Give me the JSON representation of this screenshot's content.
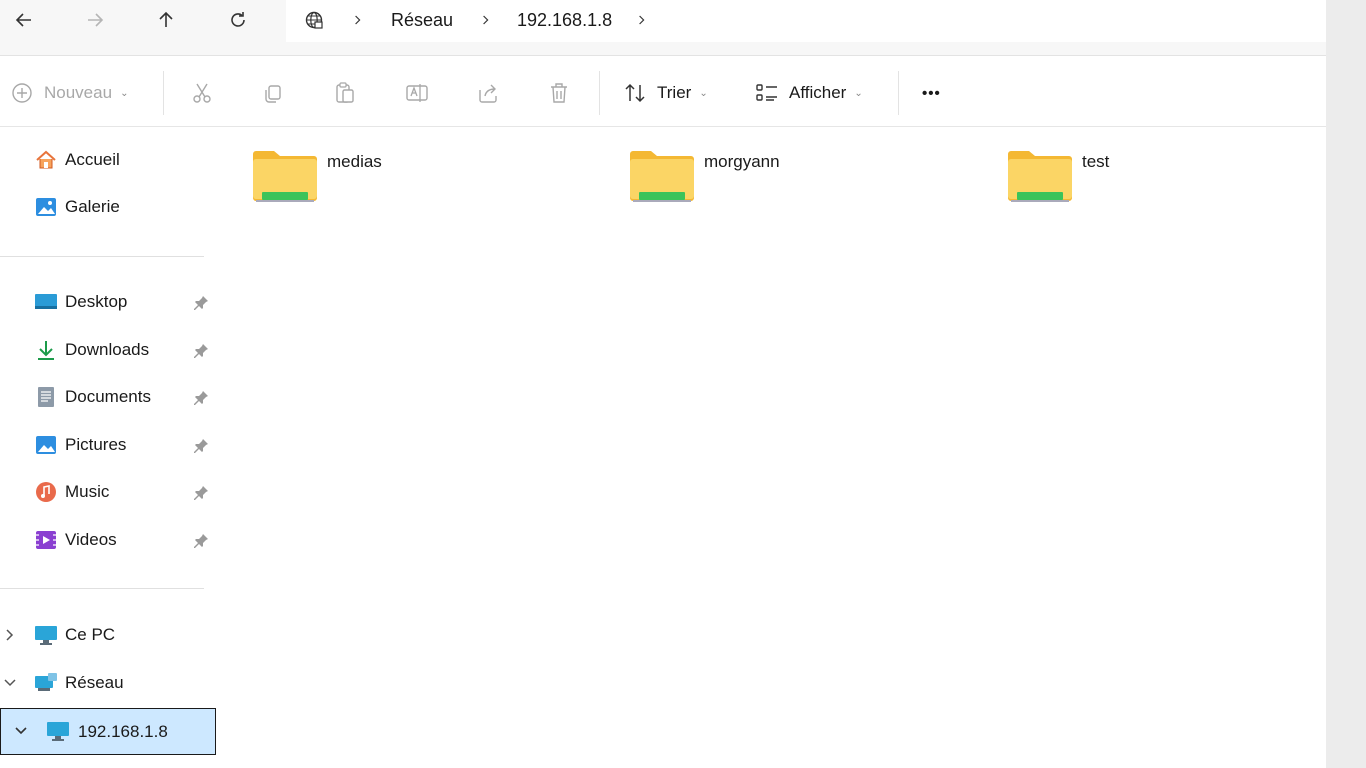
{
  "address": {
    "breadcrumbs": [
      "Réseau",
      "192.168.1.8"
    ],
    "nav_icons": [
      "back-icon",
      "forward-icon",
      "up-icon",
      "refresh-icon",
      "network-globe-icon"
    ]
  },
  "toolbar": {
    "new_label": "Nouveau",
    "sort_label": "Trier",
    "view_label": "Afficher",
    "more_label": "•••",
    "icons": [
      "cut-icon",
      "copy-icon",
      "paste-icon",
      "rename-icon",
      "share-icon",
      "delete-icon"
    ]
  },
  "sidebar": {
    "top": [
      {
        "label": "Accueil",
        "icon": "home-icon"
      },
      {
        "label": "Galerie",
        "icon": "gallery-icon"
      }
    ],
    "pinned": [
      {
        "label": "Desktop",
        "icon": "desktop-icon"
      },
      {
        "label": "Downloads",
        "icon": "download-icon"
      },
      {
        "label": "Documents",
        "icon": "documents-icon"
      },
      {
        "label": "Pictures",
        "icon": "pictures-icon"
      },
      {
        "label": "Music",
        "icon": "music-icon"
      },
      {
        "label": "Videos",
        "icon": "videos-icon"
      }
    ],
    "tree": [
      {
        "label": "Ce PC",
        "icon": "this-pc-icon",
        "expanded": false
      },
      {
        "label": "Réseau",
        "icon": "network-icon",
        "expanded": true
      },
      {
        "label": "192.168.1.8",
        "icon": "computer-icon",
        "expanded": true,
        "selected": true
      }
    ]
  },
  "content": {
    "folders": [
      {
        "name": "medias"
      },
      {
        "name": "morgyann"
      },
      {
        "name": "test"
      }
    ]
  },
  "colors": {
    "folder_yellow": "#f8cf57",
    "share_green": "#3cc35a",
    "selection": "#cde8ff",
    "accent": "#1f7fd6"
  }
}
